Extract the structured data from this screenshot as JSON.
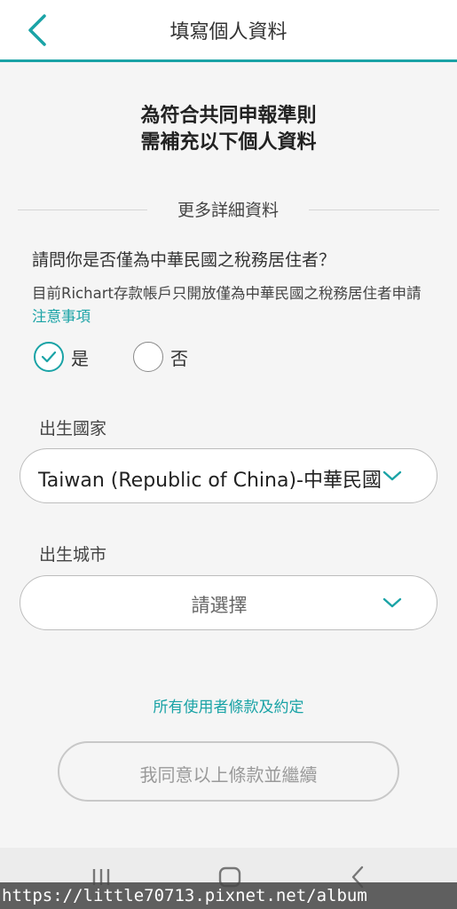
{
  "header": {
    "title": "填寫個人資料",
    "back_icon": "chevron-left-icon",
    "accent_color": "#1aa3a6"
  },
  "headline": {
    "line1": "為符合共同申報準則",
    "line2": "需補充以下個人資料"
  },
  "section": {
    "title": "更多詳細資料"
  },
  "residency": {
    "question": "請問你是否僅為中華民國之稅務居住者？",
    "note": "目前Richart存款帳戶只開放僅為中華民國之稅務居住者申請",
    "note_link": "注意事項",
    "options": [
      {
        "label": "是",
        "selected": true
      },
      {
        "label": "否",
        "selected": false
      }
    ]
  },
  "birth_country": {
    "label": "出生國家",
    "value": "Taiwan (Republic of China)-中華民國"
  },
  "birth_city": {
    "label": "出生城市",
    "placeholder": "請選擇"
  },
  "terms": {
    "link_text": "所有使用者條款及約定"
  },
  "agree_button": {
    "label": "我同意以上條款並繼續",
    "enabled": false
  },
  "nav": {
    "icons": [
      "recent-apps-icon",
      "home-icon",
      "back-icon"
    ]
  },
  "watermark": {
    "text": "https://little70713.pixnet.net/album"
  }
}
